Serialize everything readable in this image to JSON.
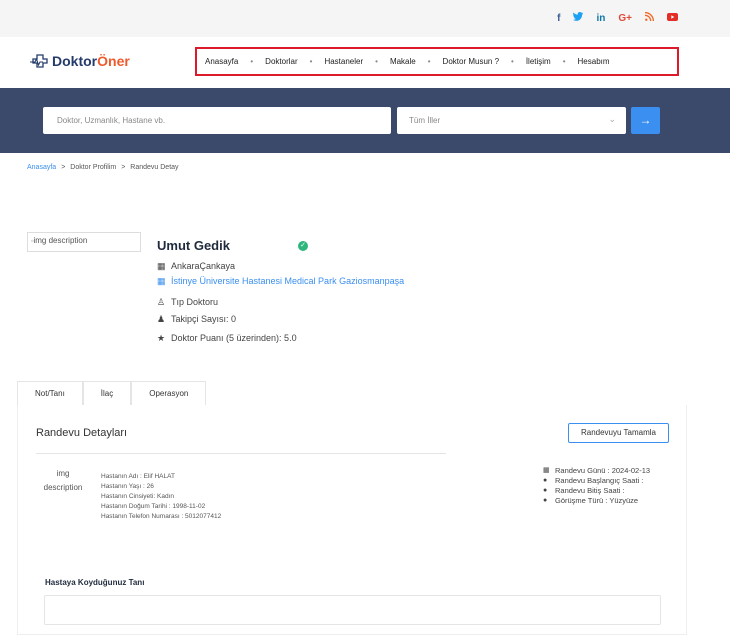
{
  "header": {
    "social": [
      {
        "icon": "facebook-icon",
        "glyph": "f",
        "color": "#3b5998"
      },
      {
        "icon": "twitter-icon",
        "glyph": "𝕥",
        "color": "#1da1f2"
      },
      {
        "icon": "linkedin-icon",
        "glyph": "in",
        "color": "#0e76a8"
      },
      {
        "icon": "google-plus-icon",
        "glyph": "G+",
        "color": "#dd4b39"
      },
      {
        "icon": "rss-icon",
        "glyph": "◉",
        "color": "#f26522"
      },
      {
        "icon": "youtube-icon",
        "glyph": "▶",
        "color": "#e52d27"
      }
    ],
    "logo_part1": "Doktor",
    "logo_part2": "Öner",
    "menu": [
      "Anasayfa",
      "Doktorlar",
      "Hastaneler",
      "Makale",
      "Doktor Musun ?",
      "İletişim",
      "Hesabım"
    ]
  },
  "search": {
    "placeholder": "Doktor, Uzmanlık, Hastane vb.",
    "city_select": "Tüm İller"
  },
  "breadcrumb": [
    "Anasayfa",
    "Doktor Profilim",
    "Randevu Detay"
  ],
  "doctor": {
    "image_alt": "img description",
    "name": "Umut Gedik",
    "location": "AnkaraÇankaya",
    "hospital": "İstinye Üniversite Hastanesi Medical Park Gaziosmanpaşa",
    "title": "Tıp Doktoru",
    "followers": "Takipçi Sayısı: 0",
    "rating": "Doktor Puanı (5 üzerinden): 5.0"
  },
  "tabs": [
    "Not/Tanı",
    "İlaç",
    "Operasyon"
  ],
  "appointment": {
    "title": "Randevu Detayları",
    "complete_button": "Randevuyu Tamamla",
    "patient_image_alt_1": "img",
    "patient_image_alt_2": "description",
    "patient": [
      "Hastanın Adı : Elif HALAT",
      "Hastanın Yaşı : 26",
      "Hastanın Cinsiyeti: Kadın",
      "Hastanın Doğum Tarihi : 1998-11-02",
      "Hastanın Telefon Numarası : 5012077412"
    ],
    "details": [
      {
        "icon": "calendar-icon",
        "text": "Randevu Günü : 2024-02-13"
      },
      {
        "icon": "clock-icon",
        "text": "Randevu Başlangıç Saati :"
      },
      {
        "icon": "clock-icon",
        "text": "Randevu Bitiş Saati :"
      },
      {
        "icon": "comment-icon",
        "text": "Görüşme Türü : Yüzyüze"
      }
    ],
    "diagnosis_label": "Hastaya Koyduğunuz Tanı"
  }
}
